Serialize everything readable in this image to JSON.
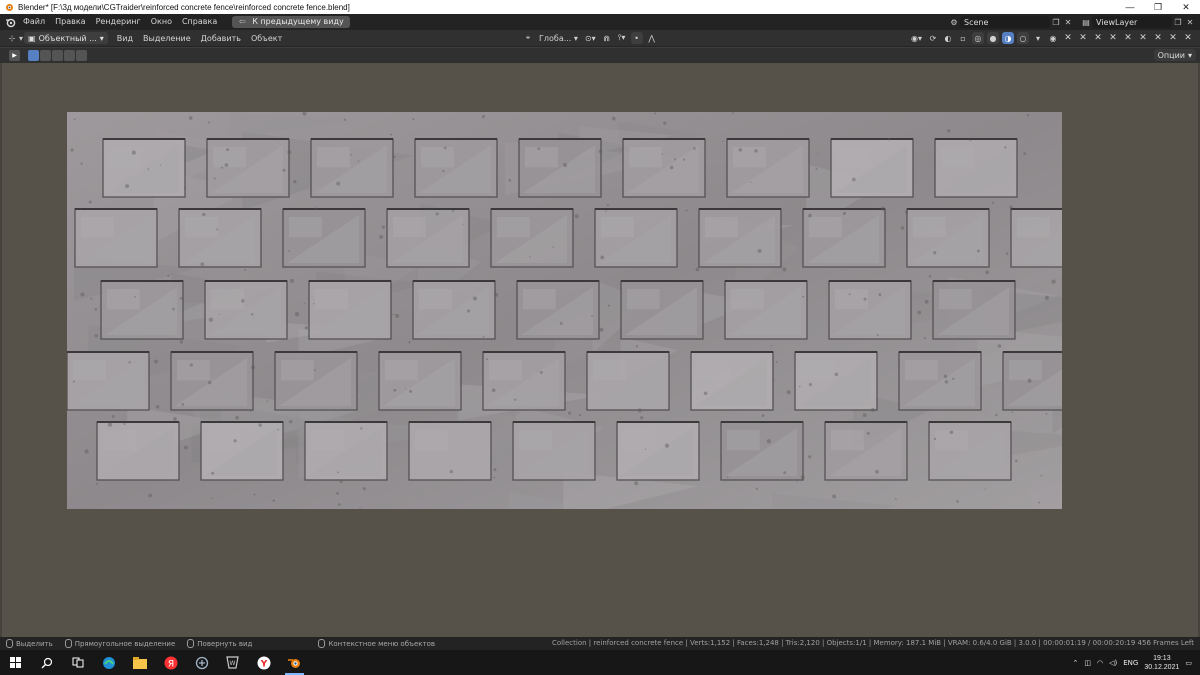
{
  "window": {
    "title": "Blender* [F:\\3д модели\\CGTraider\\reinforced concrete fence\\reinforced concrete fence.blend]",
    "minimize": "—",
    "maximize": "❐",
    "close": "✕"
  },
  "topbar": {
    "menus": [
      "Файл",
      "Правка",
      "Рендеринг",
      "Окно",
      "Справка"
    ],
    "back_button": "К предыдущему виду",
    "scene": "Scene",
    "view_layer": "ViewLayer"
  },
  "viewport_header": {
    "mode": "Объектный ...",
    "menus": [
      "Вид",
      "Выделение",
      "Добавить",
      "Объект"
    ],
    "orientation": "Глоба..."
  },
  "tool_row": {
    "options": "Опции"
  },
  "statusbar": {
    "hints": [
      "Выделить",
      "Прямоугольное выделение",
      "Повернуть вид",
      "Контекстное меню объектов"
    ],
    "stats": "Collection | reinforced concrete fence | Verts:1,152 | Faces:1,248 | Tris:2,120 | Objects:1/1 | Memory: 187.1 MiB | VRAM: 0.6/4.0 GiB | 3.0.0 | 00:00:01:19 / 00:00:20:19 456 Frames Left"
  },
  "taskbar": {
    "language": "ENG",
    "time": "19:13",
    "date": "30.12.2021"
  },
  "colors": {
    "accent": "#5680c2",
    "viewport_bg": "#56524a",
    "fence_base": "#8a8789"
  }
}
